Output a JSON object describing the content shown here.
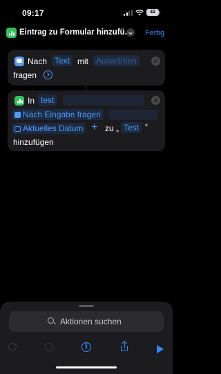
{
  "status_bar": {
    "time": "09:17",
    "battery": "32"
  },
  "header": {
    "title": "Eintrag zu Formular hinzufü...",
    "done_label": "Fertig"
  },
  "action1": {
    "word_nach": "Nach",
    "token_text": "Text",
    "word_mit": "mit",
    "token_select": "Auswählen",
    "word_fragen": "fragen"
  },
  "action2": {
    "word_in": "In",
    "token_test": "test",
    "token_ask": "Nach Eingabe fragen",
    "token_date": "Aktuelles Datum",
    "word_zu": "zu „",
    "token_test2": "Test",
    "word_quote": "“",
    "word_add": "hinzufügen"
  },
  "bottom": {
    "search_placeholder": "Aktionen suchen"
  },
  "icons": {
    "app": "spreadsheet-icon",
    "ask": "ask-input-icon",
    "calendar": "calendar-icon",
    "undo": "undo-icon",
    "redo": "redo-icon",
    "info": "info-icon",
    "share": "share-icon",
    "play": "play-icon"
  },
  "colors": {
    "accent": "#2f8cff",
    "app_green": "#30c35b",
    "card": "#1c1c1e"
  }
}
